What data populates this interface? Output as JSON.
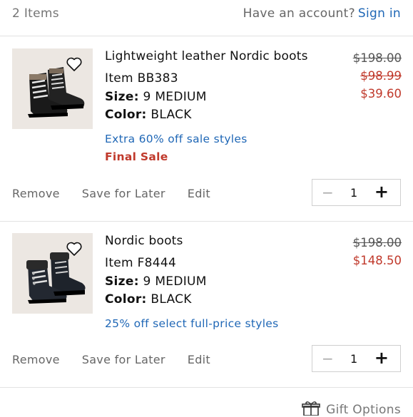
{
  "header": {
    "items_count": "2 Items",
    "account_prompt": "Have an account?",
    "sign_in": "Sign in"
  },
  "items": [
    {
      "name": "Lightweight leather Nordic boots",
      "item_number": "Item BB383",
      "size_label": "Size:",
      "size": "9 MEDIUM",
      "color_label": "Color:",
      "color": "BLACK",
      "promo": "Extra 60% off sale styles",
      "final_sale": "Final Sale",
      "price_original": "$198.00",
      "price_previous": "$98.99",
      "price_current": "$39.60",
      "quantity": "1",
      "image_icon": "lace-up-hiker-boot-icon"
    },
    {
      "name": "Nordic boots",
      "item_number": "Item F8444",
      "size_label": "Size:",
      "size": "9 MEDIUM",
      "color_label": "Color:",
      "color": "BLACK",
      "promo": "25% off select full-price styles",
      "price_original": "$198.00",
      "price_current": "$148.50",
      "quantity": "1",
      "image_icon": "shearling-cuff-boot-icon"
    }
  ],
  "actions": {
    "remove": "Remove",
    "save_for_later": "Save for Later",
    "edit": "Edit"
  },
  "qty_controls": {
    "minus": "−",
    "plus": "+"
  },
  "footer": {
    "gift_options": "Gift Options"
  },
  "colors": {
    "link_blue": "#1f67b6",
    "sale_red": "#c0392b",
    "thumb_bg": "#ece7e2",
    "divider": "#e2e2e2"
  }
}
